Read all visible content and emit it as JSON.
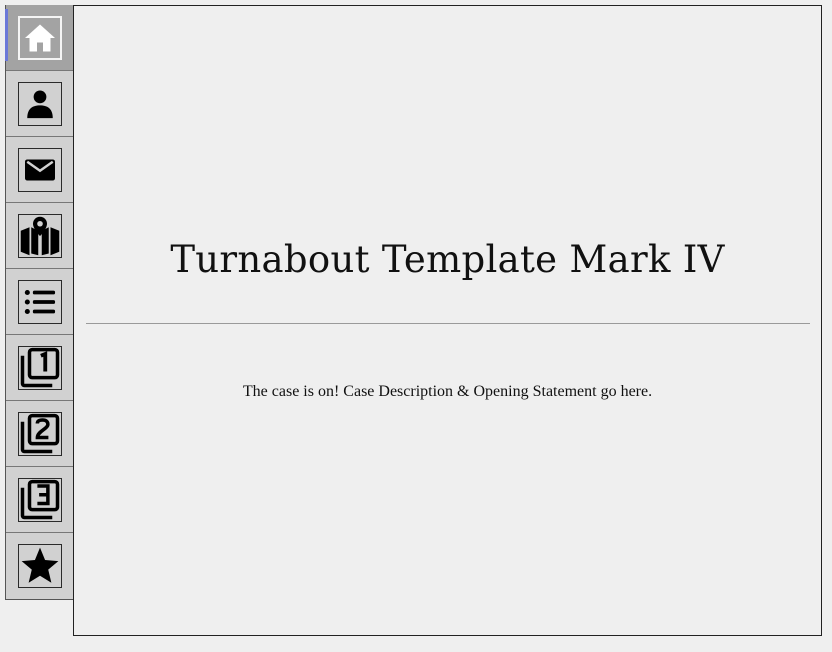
{
  "sidebar": {
    "items": [
      {
        "icon": "home-icon",
        "active": true
      },
      {
        "icon": "person-icon",
        "active": false
      },
      {
        "icon": "mail-icon",
        "active": false
      },
      {
        "icon": "map-icon",
        "active": false
      },
      {
        "icon": "list-icon",
        "active": false
      },
      {
        "icon": "filter-1-icon",
        "active": false
      },
      {
        "icon": "filter-2-icon",
        "active": false
      },
      {
        "icon": "filter-3-icon",
        "active": false
      },
      {
        "icon": "star-icon",
        "active": false
      }
    ]
  },
  "main": {
    "title": "Turnabout Template Mark IV",
    "description": "The case is on! Case Description & Opening Statement go here."
  },
  "colors": {
    "accent": "#6b78d8",
    "active_bg": "#a3a3a3",
    "sidebar_bg": "#d1d1d1",
    "page_bg": "#efefef"
  }
}
